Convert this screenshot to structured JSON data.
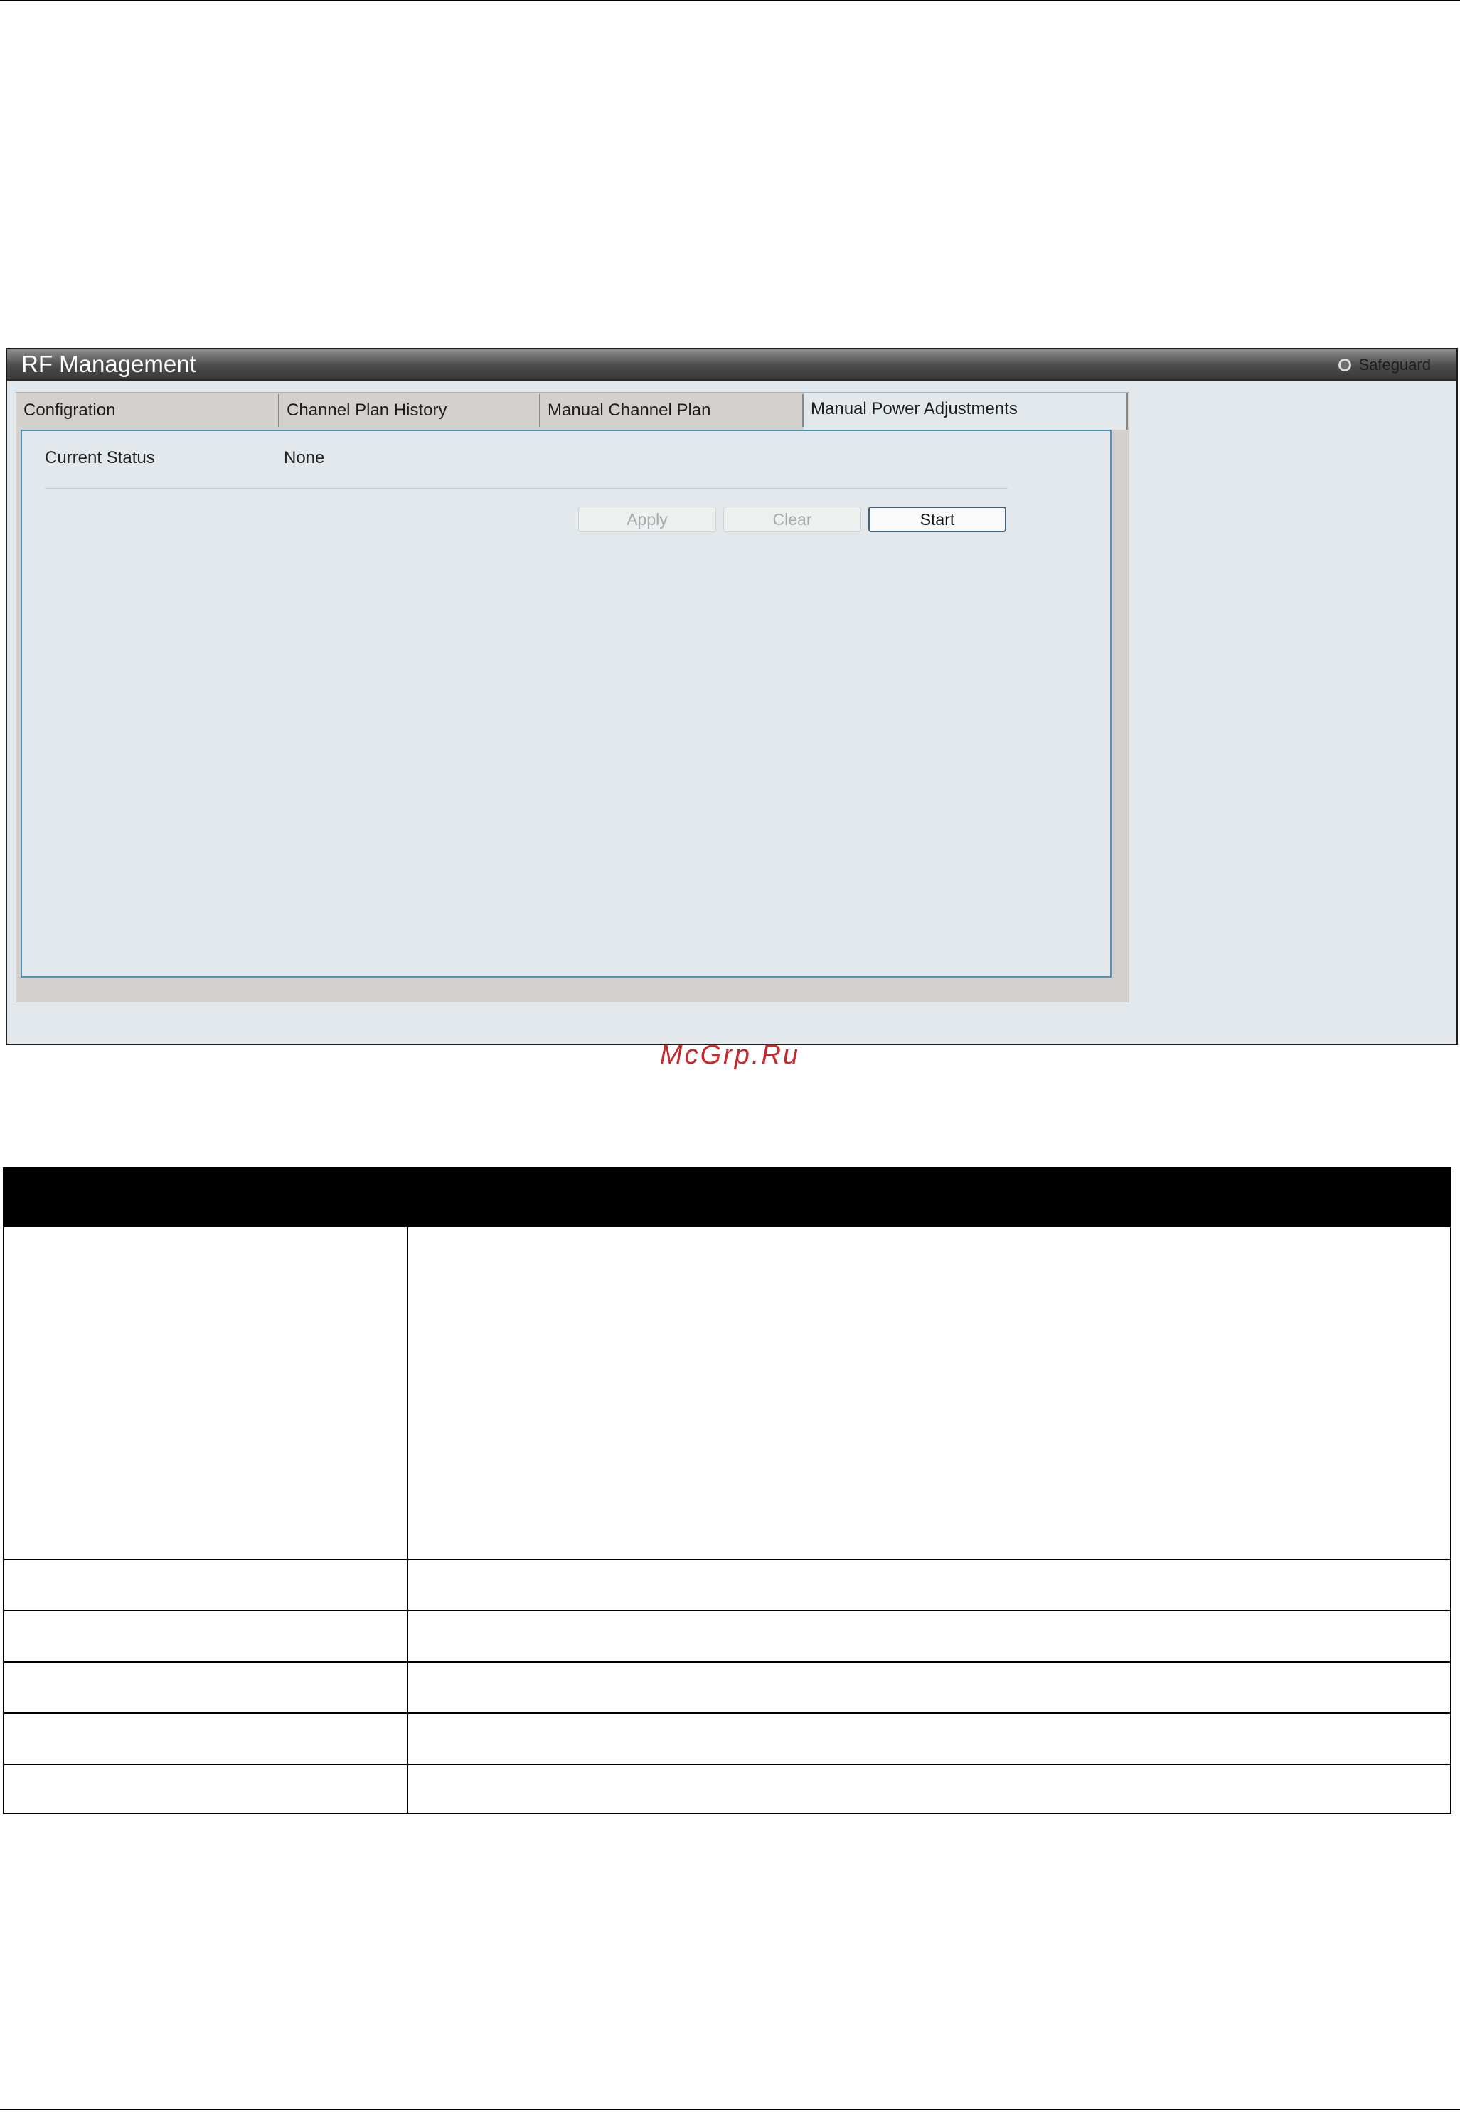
{
  "window": {
    "title": "RF Management",
    "safeguard_label": "Safeguard"
  },
  "tabs": [
    {
      "label": "Configration"
    },
    {
      "label": "Channel Plan History"
    },
    {
      "label": "Manual Channel Plan"
    },
    {
      "label": "Manual Power Adjustments",
      "active": true
    }
  ],
  "status": {
    "label": "Current Status",
    "value": "None"
  },
  "buttons": {
    "apply": "Apply",
    "clear": "Clear",
    "start": "Start"
  },
  "watermark": "McGrp.Ru"
}
